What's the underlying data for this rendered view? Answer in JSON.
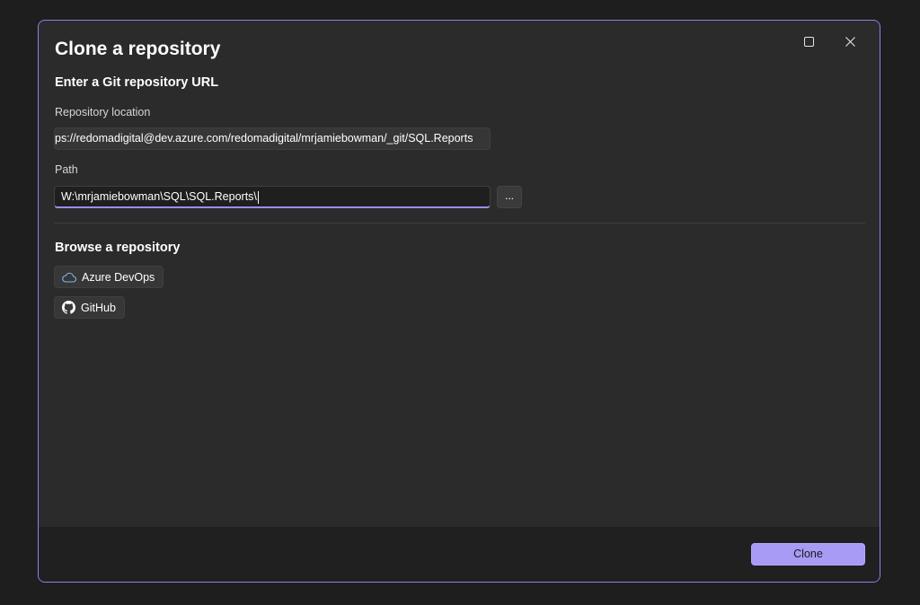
{
  "dialog": {
    "title": "Clone a repository",
    "window_controls": {
      "maximize_icon": "maximize-icon",
      "close_icon": "close-icon"
    }
  },
  "url_section": {
    "heading": "Enter a Git repository URL",
    "repository_location_label": "Repository location",
    "repository_location_value": "ps://redomadigital@dev.azure.com/redomadigital/mrjamiebowman/_git/SQL.Reports",
    "path_label": "Path",
    "path_value": "W:\\mrjamiebowman\\SQL\\SQL.Reports\\",
    "browse_button_label": "..."
  },
  "browse_section": {
    "heading": "Browse a repository",
    "azure_label": "Azure DevOps",
    "azure_icon": "cloud-icon",
    "github_label": "GitHub",
    "github_icon": "github-icon"
  },
  "footer": {
    "clone_label": "Clone"
  },
  "colors": {
    "accent": "#a79bf5",
    "dialog_border": "#8f7fe8",
    "dialog_bg": "#2b2b2b",
    "footer_bg": "#202020"
  }
}
